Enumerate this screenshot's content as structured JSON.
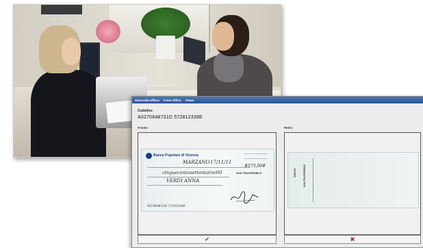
{
  "window": {
    "menu": [
      "Gioconda Ufficio",
      "Front Office",
      "Views"
    ]
  },
  "codeline": {
    "label": "Codeline:",
    "value": "A0270648731D 572812338E"
  },
  "panels": {
    "front_label": "Fronte:",
    "back_label": "Retro:"
  },
  "cheque_front": {
    "bank_name": "Banca Popolare di Vicenza",
    "date": "17/11/11",
    "place": "MARZANO",
    "amount": "#573,00#",
    "amount_words": "cinquecentosettantatre/00",
    "payee": "VERDI ANNA",
    "non_trasferibile": "NON TRASFERIBILE",
    "micr": "#0270648731# 572812338#"
  },
  "cheque_back": {
    "girata": "GIRATA",
    "non_trasferibile": "NON TRASFERIBILE"
  },
  "buttons": {
    "confirm_icon": "check-icon",
    "cancel_icon": "close-icon"
  },
  "colors": {
    "titlebar": "#2d5594",
    "confirm": "#2e8b3a",
    "cancel": "#c0322a",
    "bank": "#1d3c80"
  }
}
